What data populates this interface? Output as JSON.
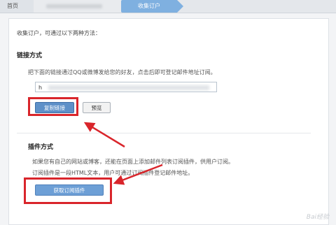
{
  "breadcrumb": {
    "home": "首页",
    "active": "收集订户"
  },
  "page": {
    "intro": "收集订户，可通过以下两种方法：",
    "link_section": {
      "title": "链接方式",
      "desc": "把下面的链接通过QQ或微博发给您的好友，点击后即可登记邮件地址订阅。",
      "url_prefix": "h",
      "copy_button": "复制链接",
      "preview_button": "预览"
    },
    "plugin_section": {
      "title": "插件方式",
      "desc1": "如果您有自己的网站或博客，还能在页面上添加邮件列表订阅插件，供用户订阅。",
      "desc2": "订阅插件是一段HTML文本，用户可通过订阅插件登记邮件地址。",
      "get_button": "获取订阅插件"
    }
  },
  "watermark": "Bai经验",
  "colors": {
    "highlight": "#d9252b",
    "primary_button": "#5e90c8",
    "breadcrumb_active": "#7fb0e0"
  }
}
